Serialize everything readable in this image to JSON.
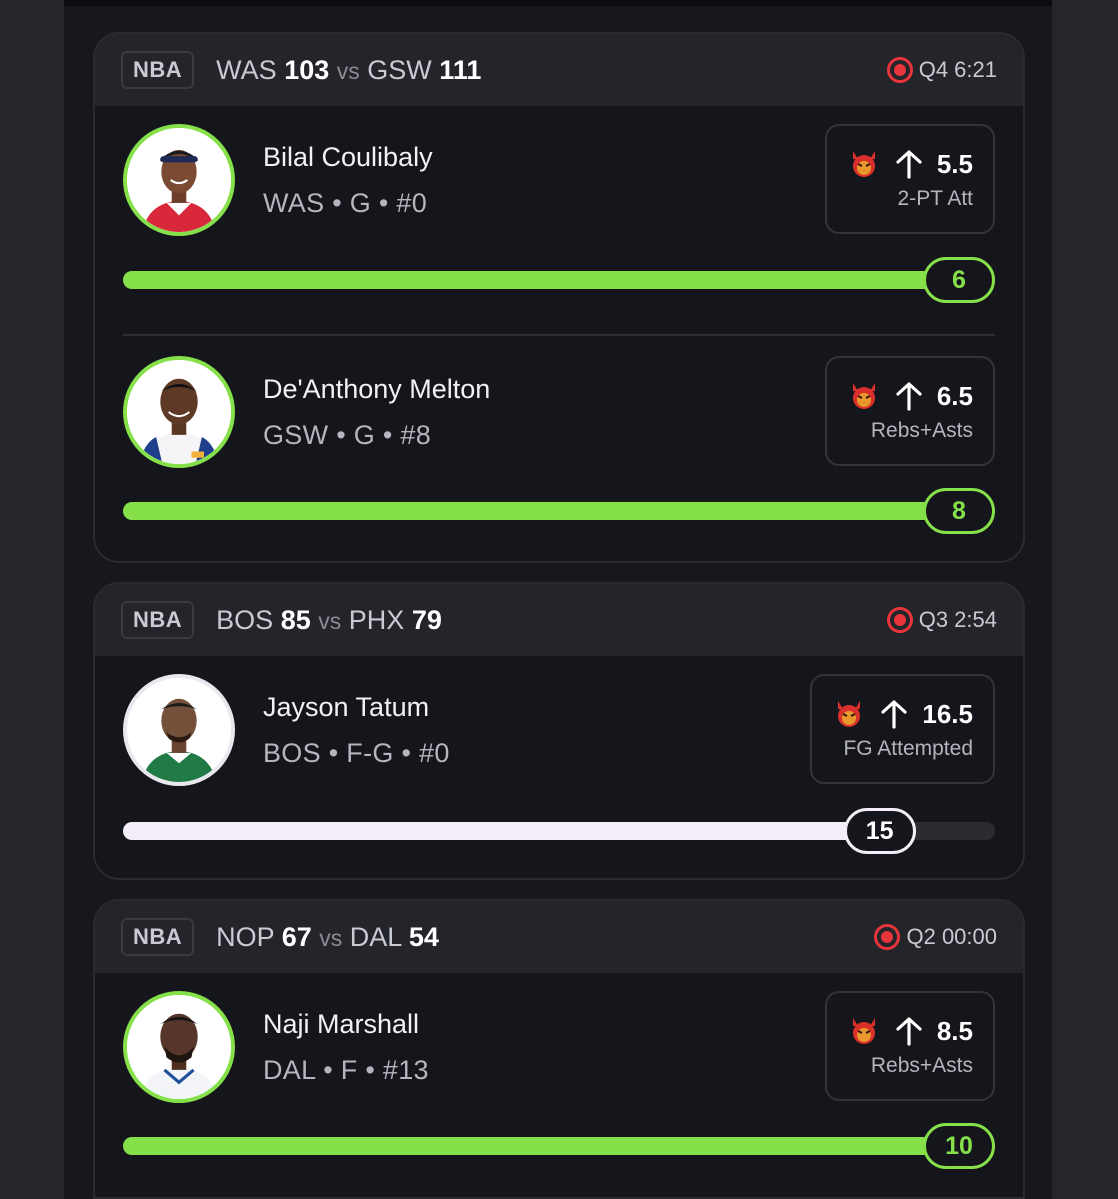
{
  "colors": {
    "accent_green": "#86e04a",
    "live_red": "#e8343b",
    "card_bg": "#15161b",
    "header_bg": "#24252b"
  },
  "games": [
    {
      "league": "NBA",
      "away_team": "WAS",
      "away_score": "103",
      "vs": "vs",
      "home_team": "GSW",
      "home_score": "111",
      "status": "Q4 6:21",
      "players": [
        {
          "name": "Bilal Coulibaly",
          "meta": "WAS • G • #0",
          "direction_icon": "arrow-up-icon",
          "line": "5.5",
          "stat": "2-PT Att",
          "current": "6",
          "progress": 1.0,
          "ring": "green"
        },
        {
          "name": "De'Anthony Melton",
          "meta": "GSW • G • #8",
          "direction_icon": "arrow-up-icon",
          "line": "6.5",
          "stat": "Rebs+Asts",
          "current": "8",
          "progress": 1.0,
          "ring": "green"
        }
      ]
    },
    {
      "league": "NBA",
      "away_team": "BOS",
      "away_score": "85",
      "vs": "vs",
      "home_team": "PHX",
      "home_score": "79",
      "status": "Q3 2:54",
      "players": [
        {
          "name": "Jayson Tatum",
          "meta": "BOS • F-G • #0",
          "direction_icon": "arrow-up-icon",
          "line": "16.5",
          "stat": "FG Attempted",
          "current": "15",
          "progress": 0.909,
          "ring": "white"
        }
      ]
    },
    {
      "league": "NBA",
      "away_team": "NOP",
      "away_score": "67",
      "vs": "vs",
      "home_team": "DAL",
      "home_score": "54",
      "status": "Q2 00:00",
      "players": [
        {
          "name": "Naji Marshall",
          "meta": "DAL • F • #13",
          "direction_icon": "arrow-up-icon",
          "line": "8.5",
          "stat": "Rebs+Asts",
          "current": "10",
          "progress": 1.0,
          "ring": "green"
        }
      ]
    }
  ]
}
